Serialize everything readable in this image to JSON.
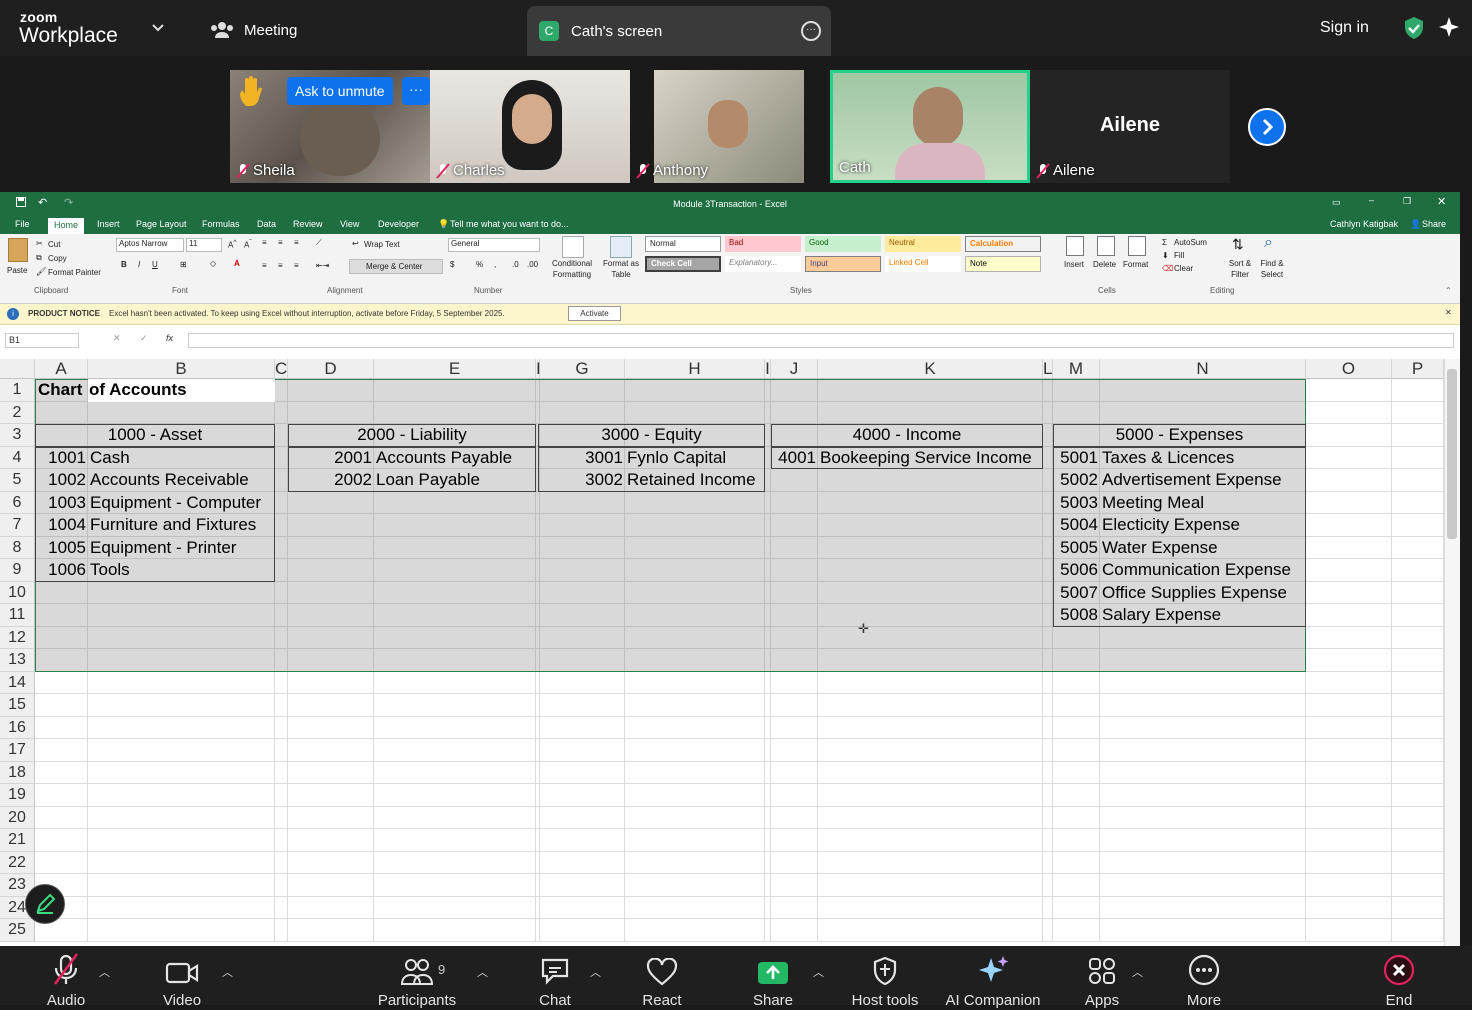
{
  "zoom": {
    "logo_small": "zoom",
    "logo_big": "Workplace",
    "meeting_label": "Meeting",
    "share_badge": "C",
    "share_title": "Cath's screen",
    "signin": "Sign in",
    "colors": {
      "accent": "#0e72ed",
      "bar": "#1f1f1f",
      "active_green": "#2ea86b",
      "excel_green": "#1e6e42",
      "end_red": "#e0245e"
    }
  },
  "participants": [
    {
      "name": "Sheila",
      "muted": true,
      "raised_hand": true
    },
    {
      "name": "Charles",
      "muted": true
    },
    {
      "name": "Anthony",
      "muted": true
    },
    {
      "name": "Cath",
      "muted": false,
      "active": true
    },
    {
      "name": "Ailene",
      "muted": true,
      "no_video_label": "Ailene"
    }
  ],
  "ask_to_unmute": "Ask to unmute",
  "ask_more": "···",
  "excel": {
    "title": "Module 3Transaction - Excel",
    "user": "Cathlyn Katigbak",
    "share": "Share",
    "tabs": [
      "File",
      "Home",
      "Insert",
      "Page Layout",
      "Formulas",
      "Data",
      "Review",
      "View",
      "Developer"
    ],
    "tell_me": "Tell me what you want to do...",
    "ribbon": {
      "paste": "Paste",
      "cut": "Cut",
      "copy": "Copy",
      "format_painter": "Format Painter",
      "clipboard": "Clipboard",
      "font_name": "Aptos Narrow",
      "font_size": "11",
      "font": "Font",
      "wrap_text": "Wrap Text",
      "merge_center": "Merge & Center",
      "alignment": "Alignment",
      "number_format": "General",
      "number": "Number",
      "conditional": "Conditional Formatting",
      "format_table": "Format as Table",
      "styles": "Styles",
      "style_cells": [
        "Normal",
        "Bad",
        "Good",
        "Neutral",
        "Calculation",
        "Check Cell",
        "Explanatory...",
        "Input",
        "Linked Cell",
        "Note"
      ],
      "insert": "Insert",
      "delete": "Delete",
      "format": "Format",
      "cells": "Cells",
      "autosum": "AutoSum",
      "fill": "Fill",
      "clear": "Clear",
      "sort_filter": "Sort & Filter",
      "find_select": "Find & Select",
      "editing": "Editing"
    },
    "notice": {
      "label": "PRODUCT NOTICE",
      "text": "Excel hasn't been activated. To keep using Excel without interruption, activate before Friday, 5 September 2025.",
      "button": "Activate"
    },
    "name_box": "B1",
    "fx": "fx",
    "columns": [
      "A",
      "B",
      "C",
      "D",
      "E",
      "I",
      "G",
      "H",
      "I",
      "J",
      "K",
      "L",
      "M",
      "N",
      "O",
      "P"
    ],
    "rows": [
      "1",
      "2",
      "3",
      "4",
      "5",
      "6",
      "7",
      "8",
      "9",
      "10",
      "11",
      "12",
      "13",
      "14",
      "15",
      "16",
      "17",
      "18",
      "19",
      "20",
      "21",
      "22",
      "23",
      "24",
      "25"
    ],
    "sheet_title_a": "Chart",
    "sheet_title_b": "of Accounts",
    "groups": [
      {
        "header": "1000 - Asset",
        "items": [
          [
            "1001",
            "Cash"
          ],
          [
            "1002",
            "Accounts Receivable"
          ],
          [
            "1003",
            "Equipment - Computer"
          ],
          [
            "1004",
            "Furniture and Fixtures"
          ],
          [
            "1005",
            "Equipment - Printer"
          ],
          [
            "1006",
            "Tools"
          ]
        ]
      },
      {
        "header": "2000 - Liability",
        "items": [
          [
            "2001",
            "Accounts Payable"
          ],
          [
            "2002",
            "Loan Payable"
          ]
        ]
      },
      {
        "header": "3000 - Equity",
        "items": [
          [
            "3001",
            "Fynlo Capital"
          ],
          [
            "3002",
            "Retained Income"
          ]
        ]
      },
      {
        "header": "4000 - Income",
        "items": [
          [
            "4001",
            "Bookeeping Service Income"
          ]
        ]
      },
      {
        "header": "5000 - Expenses",
        "items": [
          [
            "5001",
            "Taxes & Licences"
          ],
          [
            "5002",
            "Advertisement Expense"
          ],
          [
            "5003",
            "Meeting Meal"
          ],
          [
            "5004",
            "Electicity Expense"
          ],
          [
            "5005",
            "Water Expense"
          ],
          [
            "5006",
            "Communication Expense"
          ],
          [
            "5007",
            "Office Supplies Expense"
          ],
          [
            "5008",
            "Salary Expense"
          ]
        ]
      }
    ]
  },
  "toolbar": {
    "audio": "Audio",
    "video": "Video",
    "participants": "Participants",
    "participants_count": "9",
    "chat": "Chat",
    "react": "React",
    "share": "Share",
    "host_tools": "Host tools",
    "ai_companion": "AI Companion",
    "apps": "Apps",
    "more": "More",
    "end": "End"
  }
}
